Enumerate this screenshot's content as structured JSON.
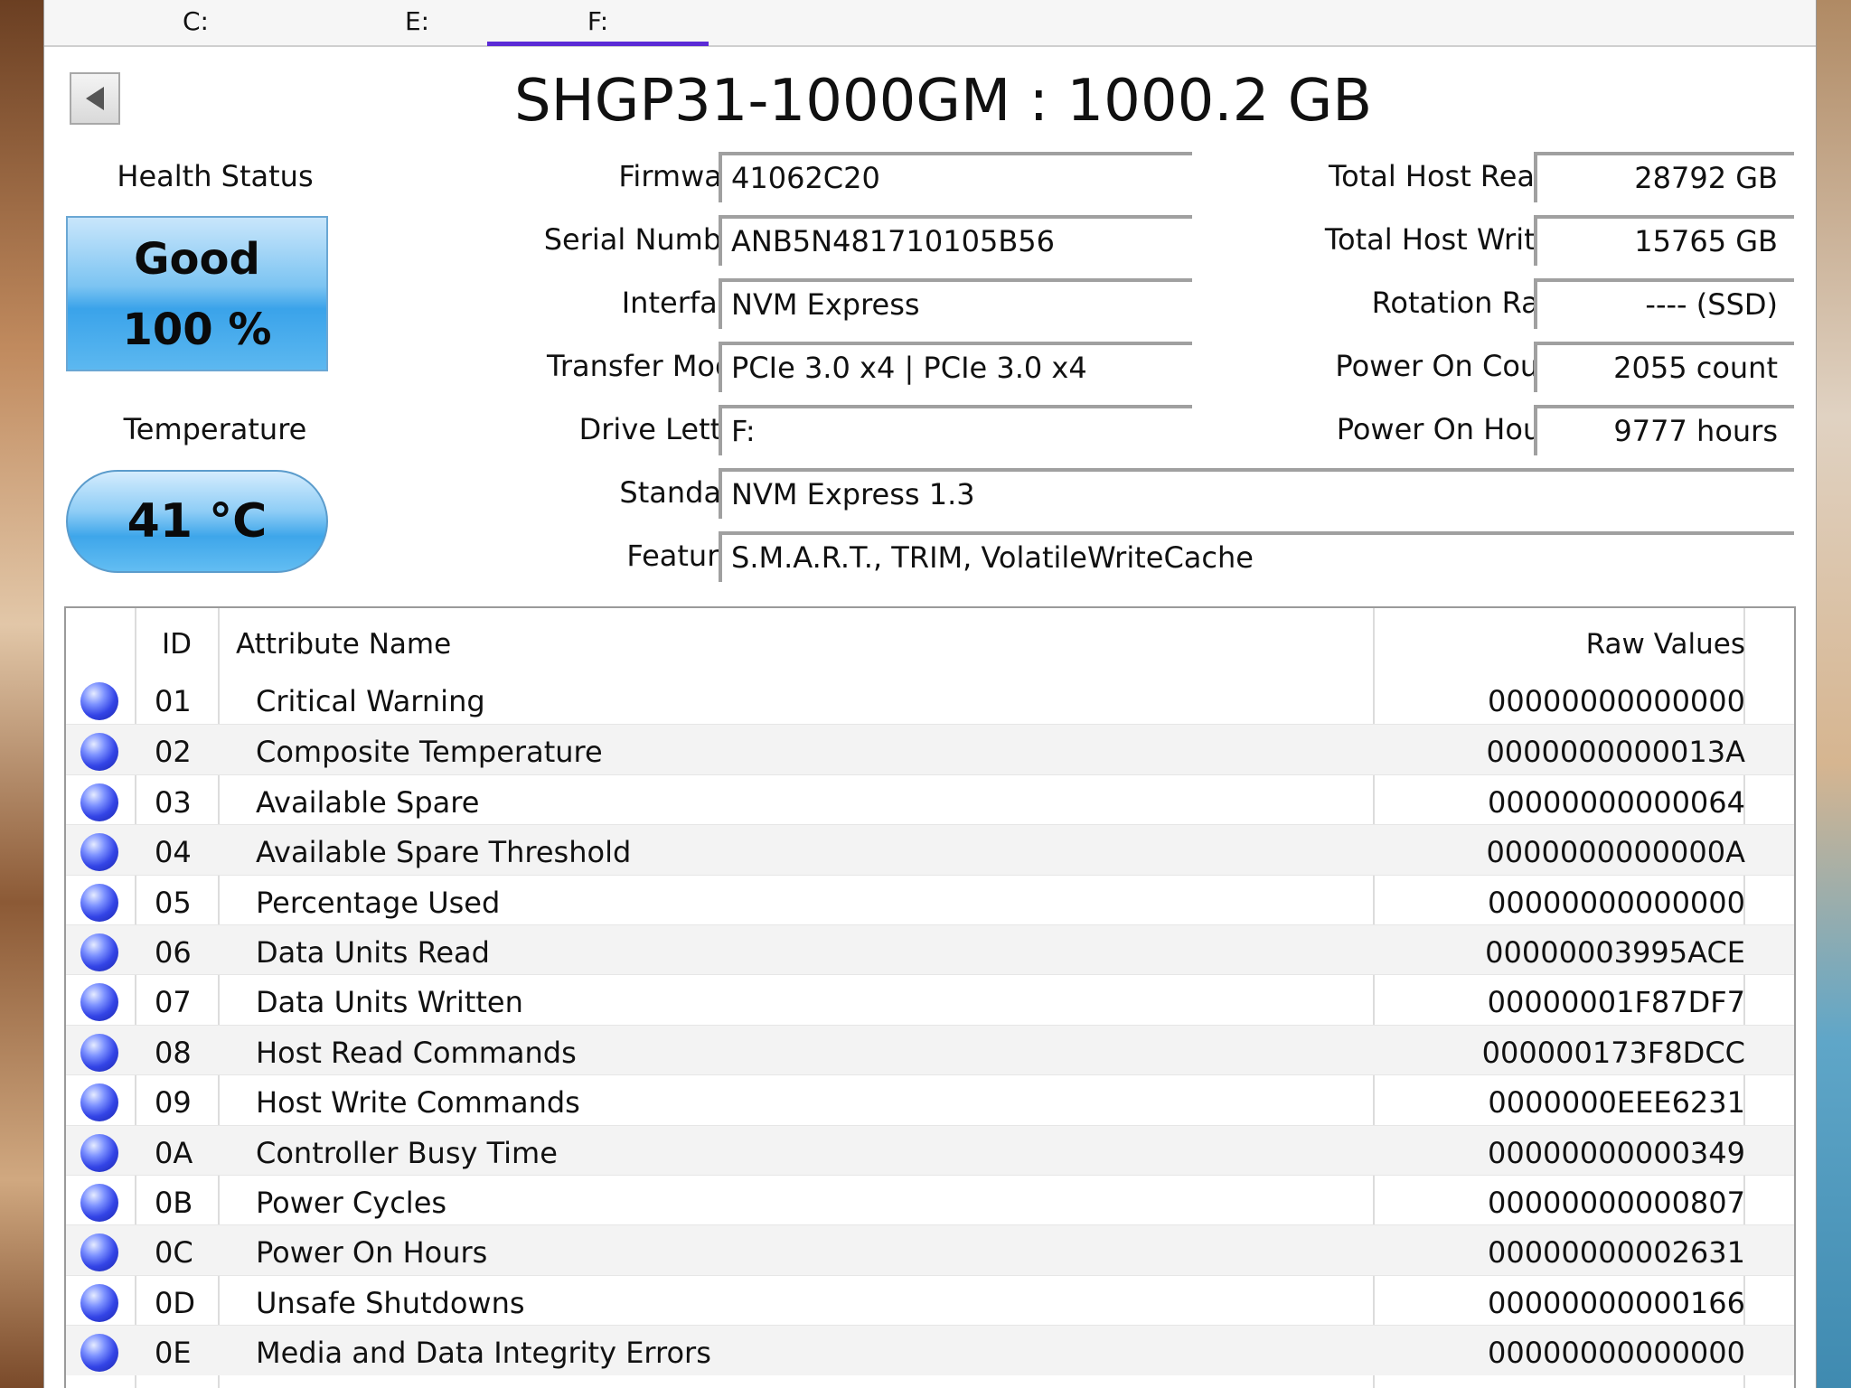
{
  "tabs": [
    {
      "label": "C:"
    },
    {
      "label": "E:"
    },
    {
      "label": "F:",
      "active": true
    }
  ],
  "drive_title": "SHGP31-1000GM : 1000.2 GB",
  "health": {
    "label": "Health Status",
    "status": "Good",
    "percent": "100 %",
    "color": "#3aa3ea"
  },
  "temperature": {
    "label": "Temperature",
    "value": "41 °C"
  },
  "info_left": [
    {
      "label": "Firmware",
      "value": "41062C20"
    },
    {
      "label": "Serial Number",
      "value": "ANB5N481710105B56"
    },
    {
      "label": "Interface",
      "value": "NVM Express"
    },
    {
      "label": "Transfer Mode",
      "value": "PCIe 3.0 x4 | PCIe 3.0 x4"
    },
    {
      "label": "Drive Letter",
      "value": "F:"
    },
    {
      "label": "Standard",
      "value": "NVM Express 1.3"
    },
    {
      "label": "Features",
      "value": "S.M.A.R.T., TRIM, VolatileWriteCache"
    }
  ],
  "info_right": [
    {
      "label": "Total Host Reads",
      "value": "28792 GB"
    },
    {
      "label": "Total Host Writes",
      "value": "15765 GB"
    },
    {
      "label": "Rotation Rate",
      "value": "---- (SSD)"
    },
    {
      "label": "Power On Count",
      "value": "2055 count"
    },
    {
      "label": "Power On Hours",
      "value": "9777 hours"
    }
  ],
  "table": {
    "headers": {
      "id": "ID",
      "name": "Attribute Name",
      "raw": "Raw Values"
    },
    "rows": [
      {
        "id": "01",
        "name": "Critical Warning",
        "raw": "00000000000000"
      },
      {
        "id": "02",
        "name": "Composite Temperature",
        "raw": "0000000000013A"
      },
      {
        "id": "03",
        "name": "Available Spare",
        "raw": "00000000000064"
      },
      {
        "id": "04",
        "name": "Available Spare Threshold",
        "raw": "0000000000000A"
      },
      {
        "id": "05",
        "name": "Percentage Used",
        "raw": "00000000000000"
      },
      {
        "id": "06",
        "name": "Data Units Read",
        "raw": "00000003995ACE"
      },
      {
        "id": "07",
        "name": "Data Units Written",
        "raw": "00000001F87DF7"
      },
      {
        "id": "08",
        "name": "Host Read Commands",
        "raw": "000000173F8DCC"
      },
      {
        "id": "09",
        "name": "Host Write Commands",
        "raw": "0000000EEE6231"
      },
      {
        "id": "0A",
        "name": "Controller Busy Time",
        "raw": "00000000000349"
      },
      {
        "id": "0B",
        "name": "Power Cycles",
        "raw": "00000000000807"
      },
      {
        "id": "0C",
        "name": "Power On Hours",
        "raw": "00000000002631"
      },
      {
        "id": "0D",
        "name": "Unsafe Shutdowns",
        "raw": "00000000000166"
      },
      {
        "id": "0E",
        "name": "Media and Data Integrity Errors",
        "raw": "00000000000000"
      }
    ]
  }
}
